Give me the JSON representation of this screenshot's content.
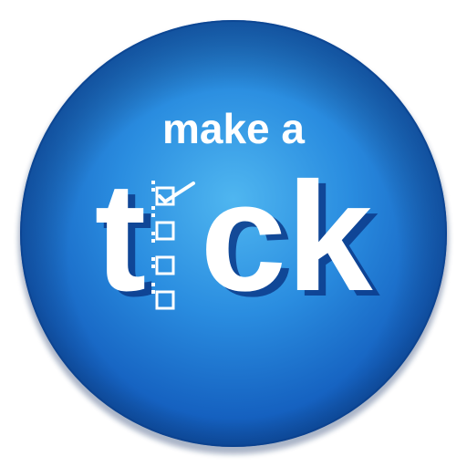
{
  "logo": {
    "line1": "make a",
    "word_start": "t",
    "word_end": "ck",
    "checkbox_count": 4,
    "checked_count": 1
  },
  "colors": {
    "disc_light": "#3aa6e8",
    "disc_mid": "#1b78cf",
    "disc_dark": "#0f4ea3",
    "rim": "#0a3f8c",
    "text": "#ffffff",
    "shadow_letters": "#0b3a8a"
  }
}
